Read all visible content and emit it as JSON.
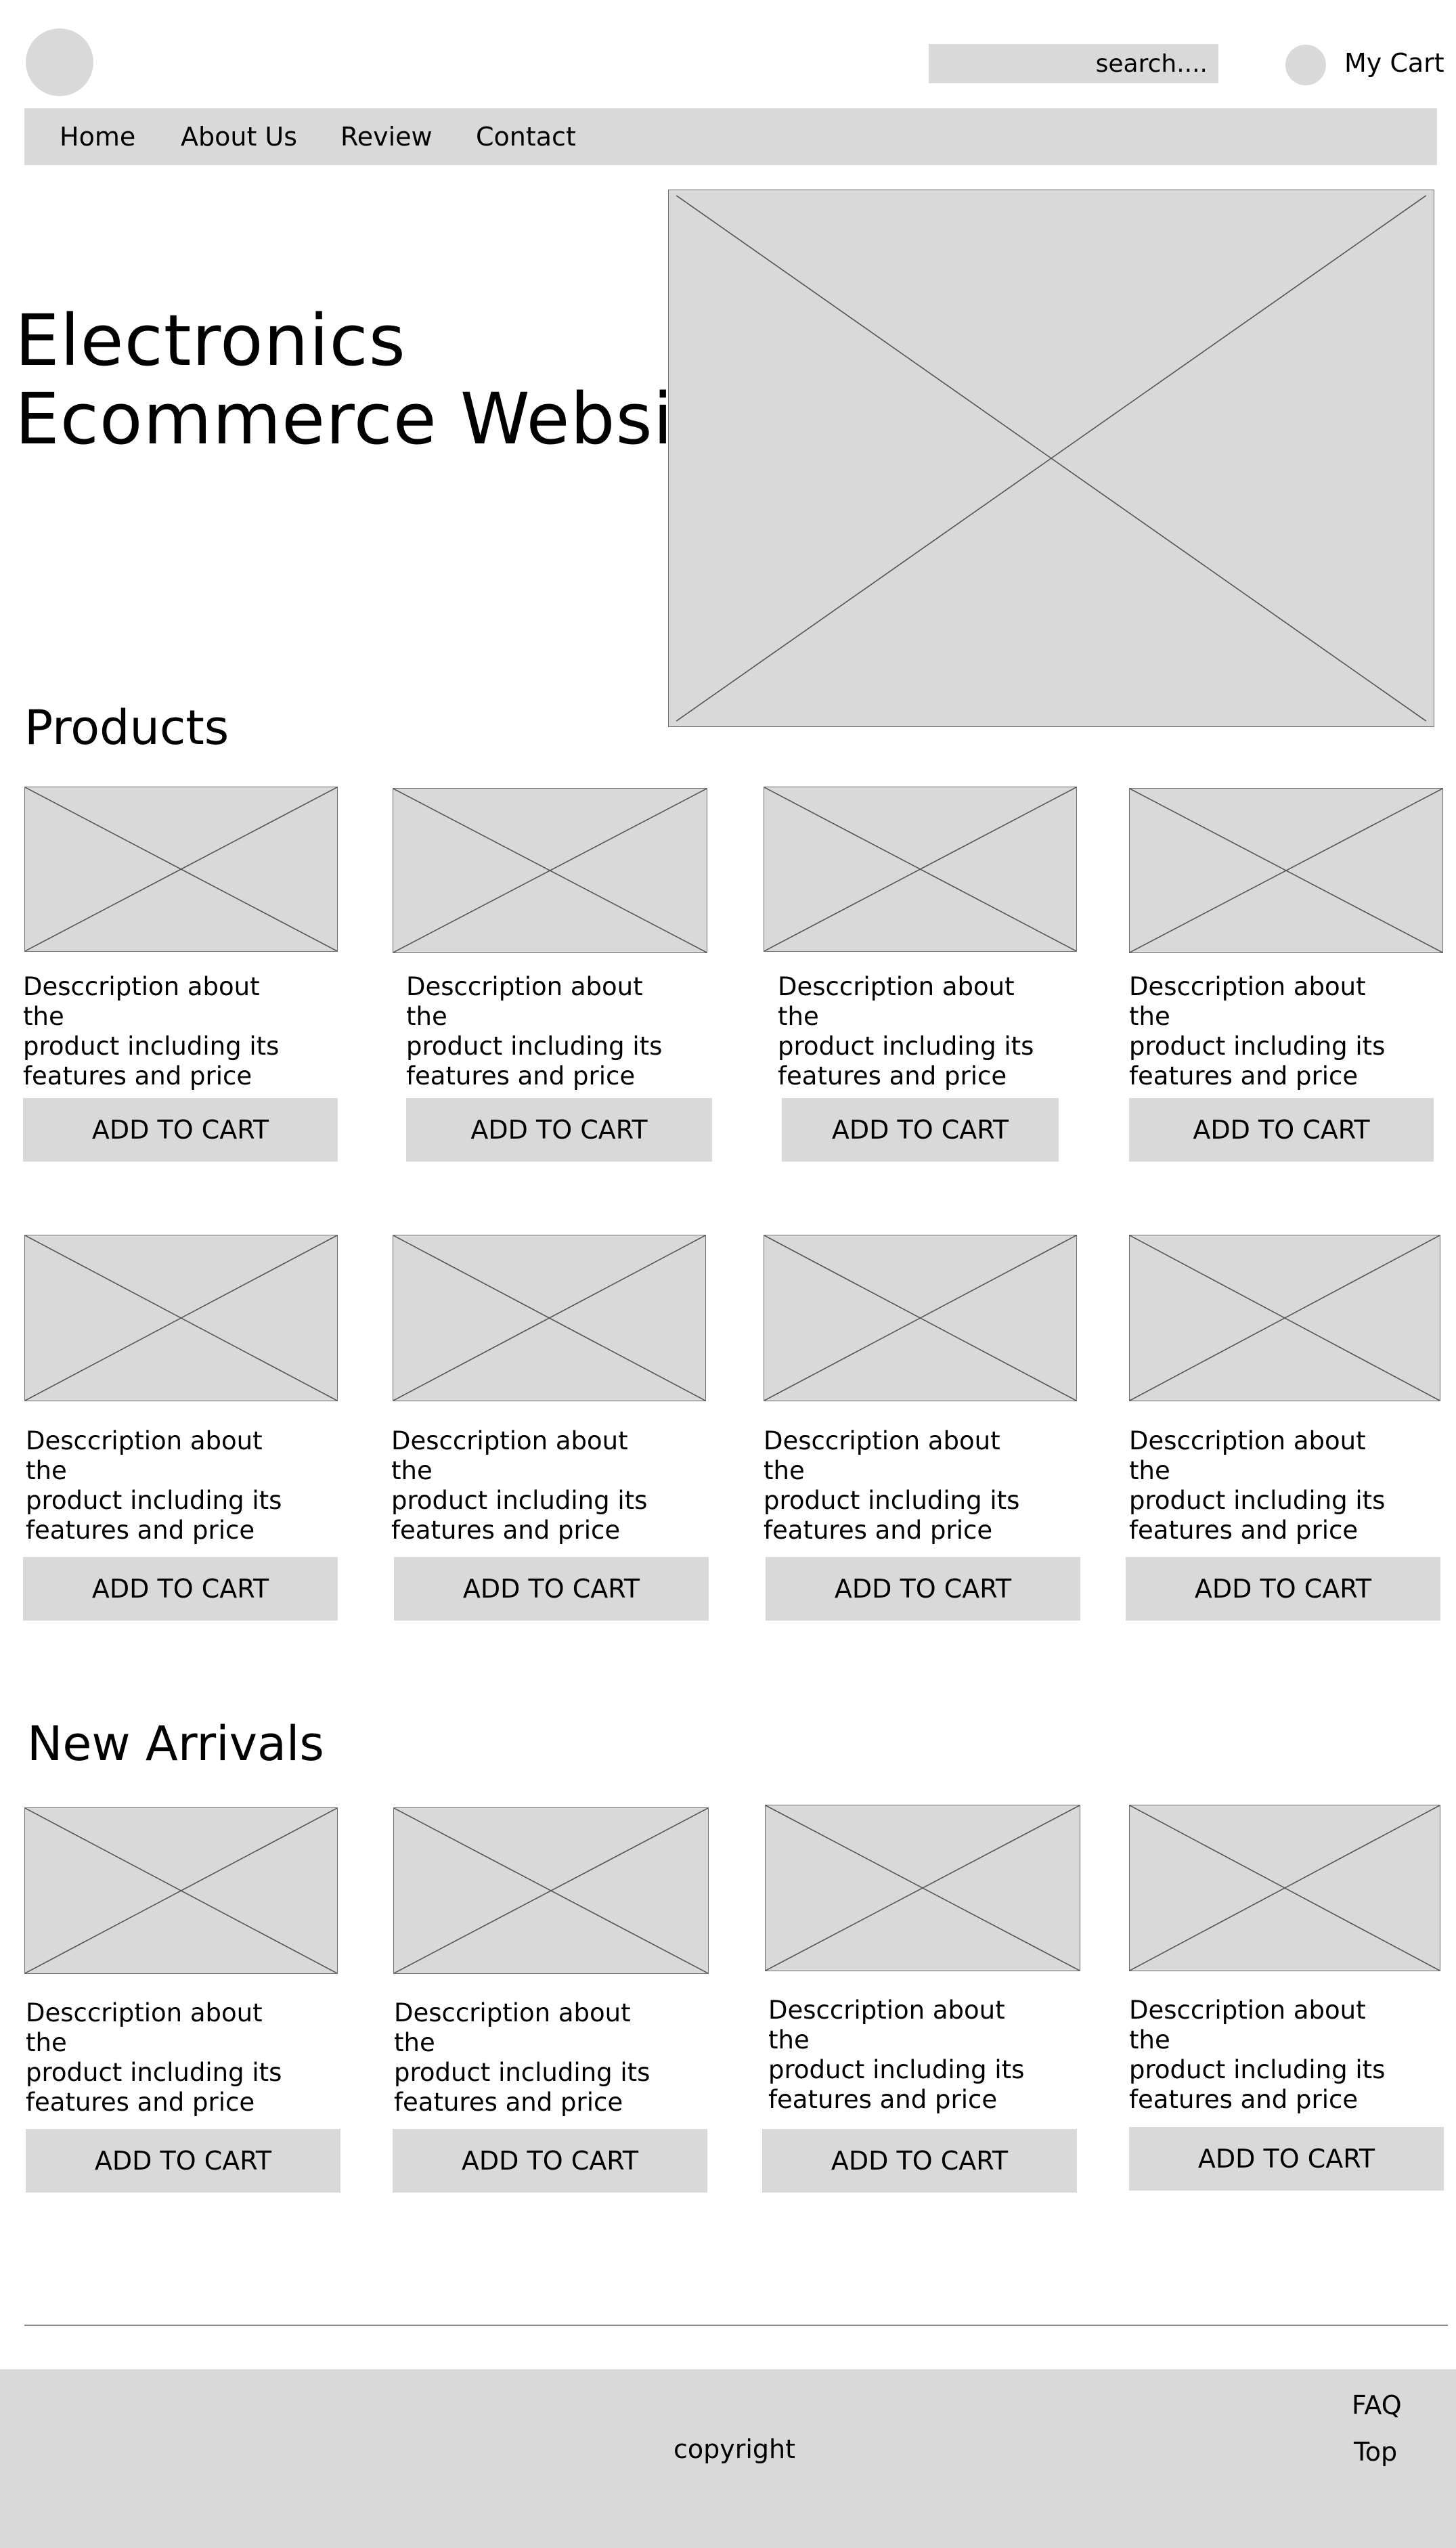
{
  "header": {
    "search_placeholder": "search....",
    "cart_label": "My Cart"
  },
  "nav": {
    "items": [
      "Home",
      "About Us",
      "Review",
      "Contact"
    ]
  },
  "hero": {
    "title_line1": "Electronics",
    "title_line2": "Ecommerce Website"
  },
  "products": {
    "title": "Products",
    "description_lines": [
      "Desccription about the",
      "product including its",
      "features and price"
    ],
    "button_label": "ADD TO CART"
  },
  "new_arrivals": {
    "title": "New Arrivals",
    "description_lines": [
      "Desccription about the",
      "product including its",
      "features and price"
    ],
    "button_label": "ADD TO CART"
  },
  "footer": {
    "copyright": "copyright",
    "faq": "FAQ",
    "top": "Top"
  },
  "colors": {
    "placeholder_gray": "#d9d9d9",
    "text": "#000000",
    "background": "#ffffff"
  }
}
